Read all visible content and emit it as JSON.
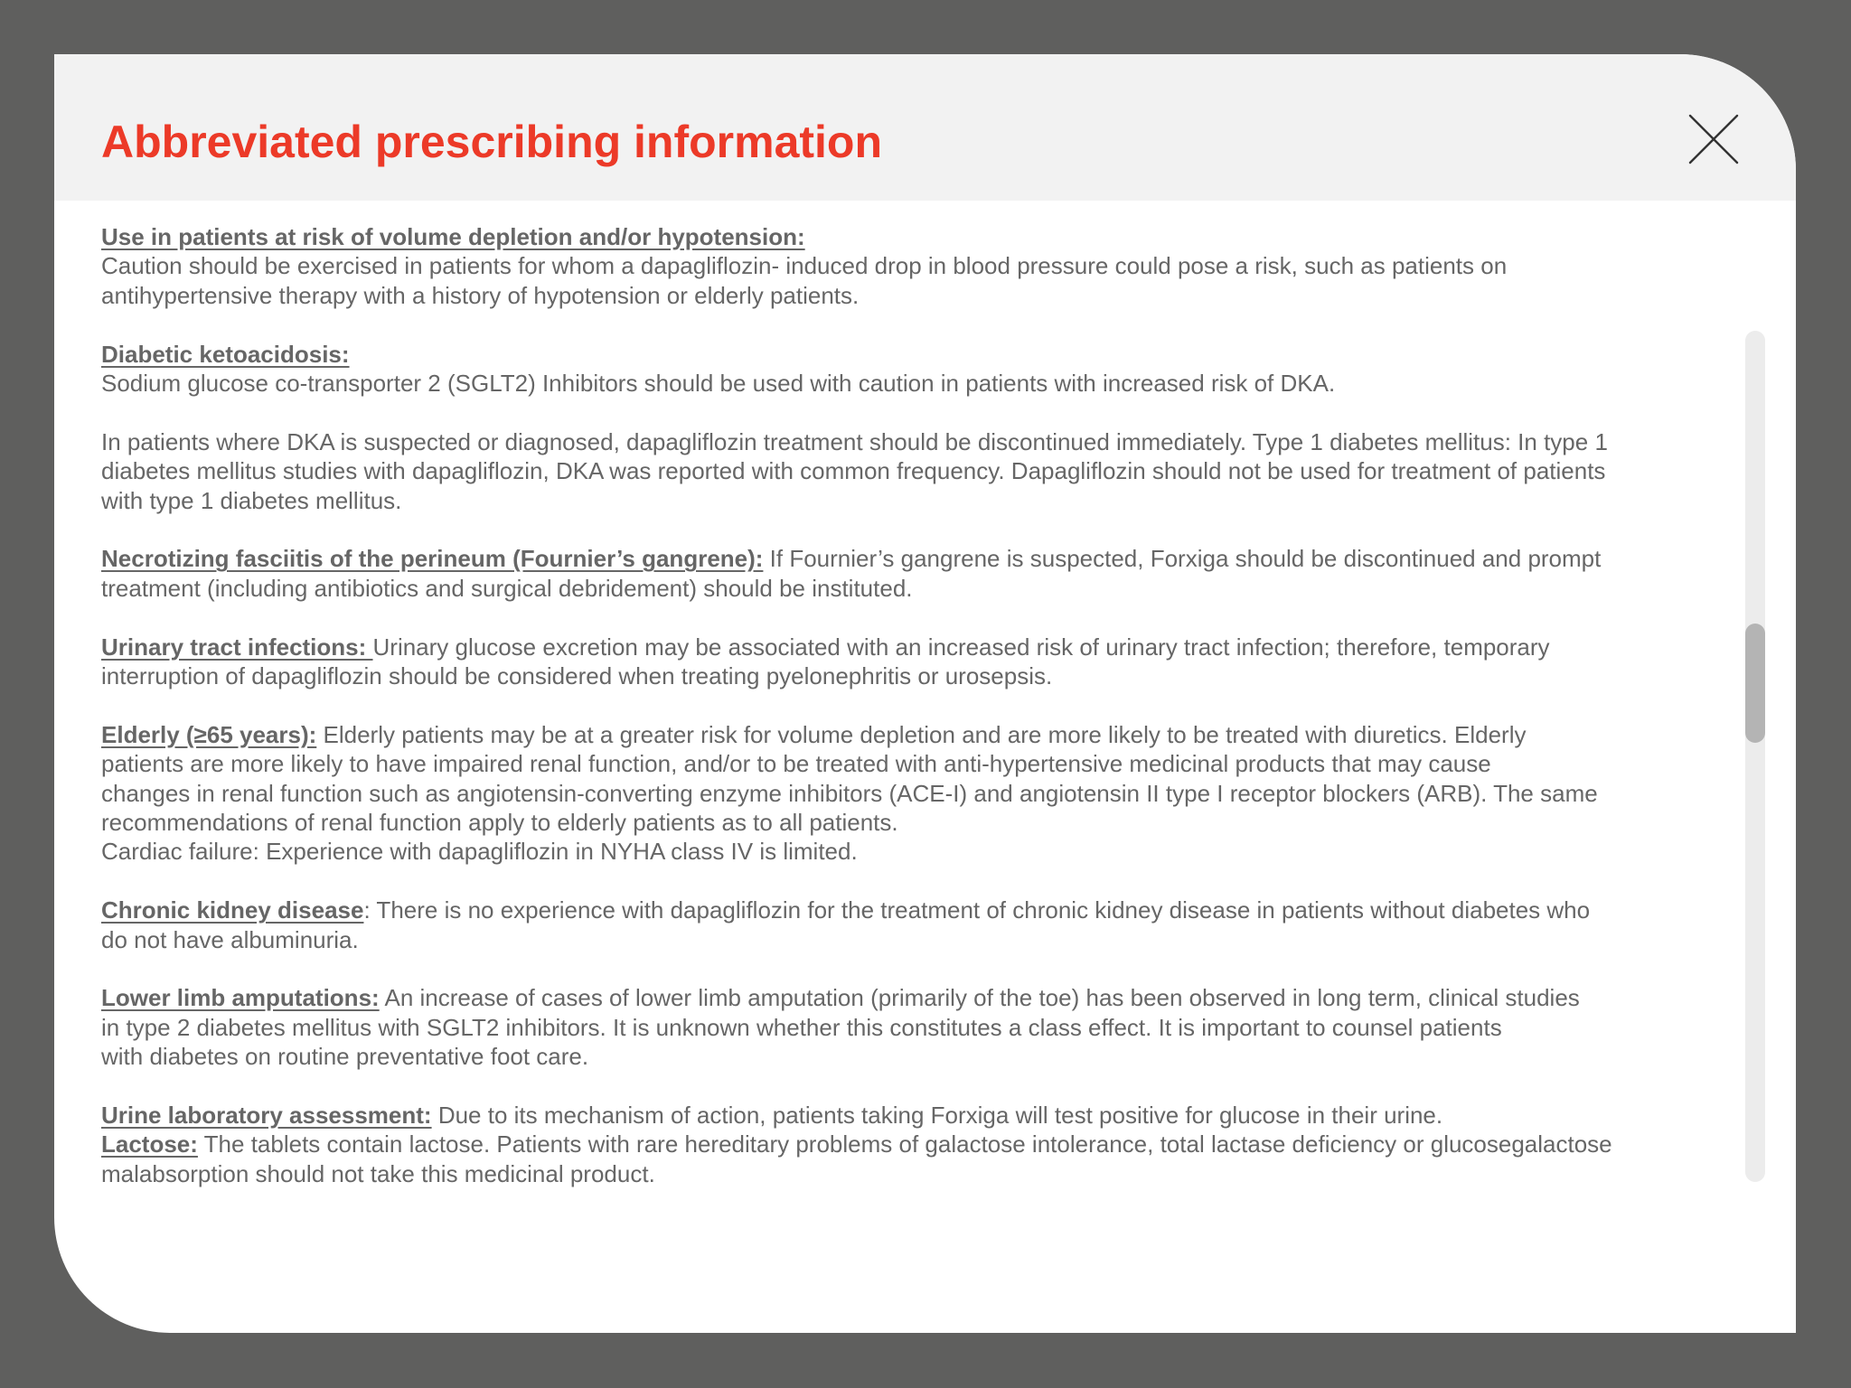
{
  "modal": {
    "title": "Abbreviated prescribing information",
    "close_icon": "close-icon",
    "scroll_position": 0.4,
    "colors": {
      "title": "#ec3a28",
      "text": "#666666",
      "header_bg": "#f2f2f2",
      "backdrop": "#5f5f5e"
    }
  },
  "sections": {
    "volume": {
      "heading": "Use in patients at risk of volume depletion and/or hypotension:",
      "line1": "Caution should be exercised in patients for whom a dapagliflozin- induced drop in blood pressure could pose a risk, such as patients on",
      "line2": "antihypertensive therapy with a history of hypotension or elderly patients."
    },
    "dka": {
      "heading": "Diabetic ketoacidosis:",
      "line1": "Sodium glucose co-transporter 2 (SGLT2) Inhibitors should be used with caution in patients with increased risk of DKA."
    },
    "dka2": {
      "line1": "In patients where DKA is suspected or diagnosed, dapagliflozin treatment should be discontinued immediately. Type 1 diabetes mellitus: In type 1",
      "line2": "diabetes mellitus studies with dapagliflozin, DKA was reported with common frequency. Dapagliflozin should not be used for treatment of patients",
      "line3": "with type 1 diabetes mellitus."
    },
    "fournier": {
      "heading": "Necrotizing fasciitis of the perineum (Fournier’s gangrene):",
      "line1": " If Fournier’s gangrene is suspected, Forxiga should be discontinued and prompt",
      "line2": "treatment (including antibiotics and surgical debridement) should be instituted."
    },
    "uti": {
      "heading": "Urinary tract infections: ",
      "line1": "Urinary glucose excretion may be associated with an increased risk of urinary tract infection; therefore, temporary",
      "line2": "interruption of dapagliflozin should be considered when treating pyelonephritis or urosepsis."
    },
    "elderly": {
      "heading": "Elderly (≥65 years):",
      "line1": " Elderly patients may be at a greater risk for volume depletion and are more likely to be treated with diuretics. Elderly",
      "line2": "patients are more likely to have impaired renal function, and/or to be treated with anti-hypertensive medicinal products that may cause",
      "line3": "changes in renal function such as angiotensin-converting enzyme inhibitors (ACE-I) and angiotensin II type I receptor blockers (ARB). The same",
      "line4": "recommendations of renal function apply to elderly patients as to all patients.",
      "line5": "Cardiac failure: Experience with dapagliflozin in NYHA class IV is limited."
    },
    "ckd": {
      "heading": "Chronic kidney disease",
      "line1": ": There is no experience with dapagliflozin for the treatment of chronic kidney disease in patients without diabetes who",
      "line2": "do not have albuminuria."
    },
    "amputation": {
      "heading": "Lower limb amputations:",
      "line1": " An increase of cases of lower limb amputation (primarily of the toe) has been observed in long term, clinical studies",
      "line2": "in type 2 diabetes mellitus with SGLT2 inhibitors. It is unknown whether this constitutes a class effect. It is important to counsel patients",
      "line3": "with diabetes on routine preventative foot care."
    },
    "urine": {
      "heading": "Urine laboratory assessment:",
      "line1": " Due to its mechanism of action, patients taking Forxiga will test positive for glucose in their urine."
    },
    "lactose": {
      "heading": "Lactose:",
      "line1": " The tablets contain lactose. Patients with rare hereditary problems of galactose intolerance, total lactase deficiency or glucosegalactose",
      "line2": "malabsorption should not take this medicinal product."
    }
  }
}
